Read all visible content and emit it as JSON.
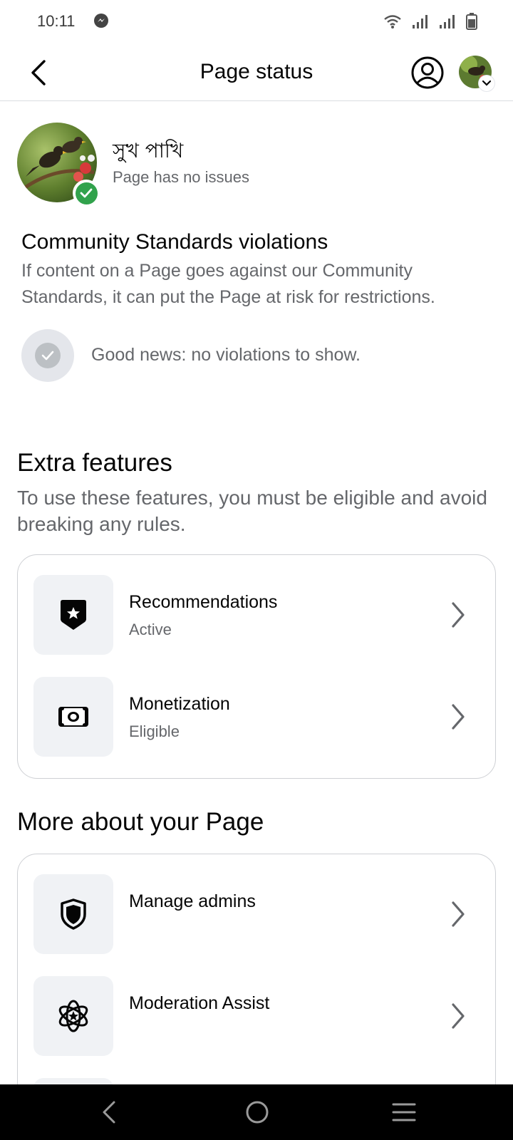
{
  "status_bar": {
    "time": "10:11"
  },
  "app_bar": {
    "title": "Page status"
  },
  "page": {
    "name": "সুখ পাখি",
    "status": "Page has no issues"
  },
  "community_standards": {
    "title": "Community Standards violations",
    "description": "If content on a Page goes against our Community Standards, it can put the Page at risk for restrictions.",
    "status_text": "Good news: no violations to show."
  },
  "extra_features": {
    "title": "Extra features",
    "description": "To use these features, you must be eligible and avoid breaking any rules.",
    "items": [
      {
        "label": "Recommendations",
        "status": "Active",
        "icon": "badge-star-icon"
      },
      {
        "label": "Monetization",
        "status": "Eligible",
        "icon": "money-icon"
      }
    ]
  },
  "more_about": {
    "title": "More about your Page",
    "items": [
      {
        "label": "Manage admins",
        "icon": "shield-icon"
      },
      {
        "label": "Moderation Assist",
        "icon": "atom-star-icon"
      }
    ]
  },
  "colors": {
    "verified_green": "#31a24c",
    "secondary_text": "#65676b",
    "tile_bg": "#f0f2f5",
    "card_border": "#ced0d4"
  }
}
